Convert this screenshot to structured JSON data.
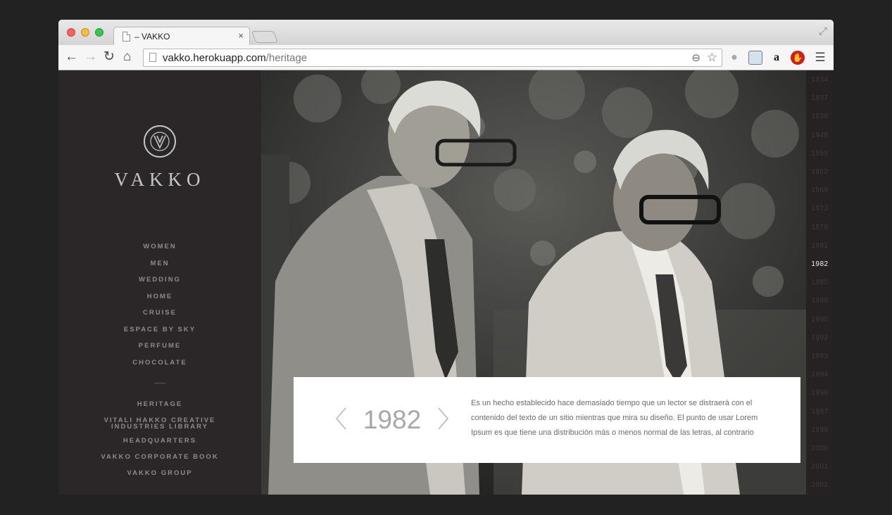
{
  "browser": {
    "tab_title": "– VAKKO",
    "tab_close": "×",
    "url_host": "vakko.herokuapp.com",
    "url_path": "/heritage"
  },
  "sidebar": {
    "logo_text": "VAKKO",
    "nav": [
      "WOMEN",
      "MEN",
      "WEDDING",
      "HOME",
      "CRUISE",
      "ESPACE BY SKY",
      "PERFUME",
      "CHOCOLATE"
    ],
    "nav_secondary": [
      {
        "label": "HERITAGE"
      },
      {
        "label": "VITALI HAKKO CREATIVE INDUSTRIES LIBRARY"
      },
      {
        "label": "HEADQUARTERS"
      },
      {
        "label": "VAKKO CORPORATE BOOK"
      },
      {
        "label": "VAKKO GROUP"
      }
    ]
  },
  "timeline": {
    "years": [
      "1934",
      "1937",
      "1938",
      "1948",
      "1955",
      "1962",
      "1969",
      "1973",
      "1979",
      "1981",
      "1982",
      "1985",
      "1989",
      "1990",
      "1992",
      "1993",
      "1994",
      "1996",
      "1997",
      "1998",
      "2000",
      "2001",
      "2002"
    ],
    "active": "1982"
  },
  "caption": {
    "year": "1982",
    "text": "Es un hecho establecido hace demasiado tiempo que un lector se distraerá con el contenido del texto de un sitio mientras que mira su diseño. El punto de usar Lorem Ipsum es que tiene una distribución más o menos normal de las letras, al contrario"
  },
  "colors": {
    "sidebar_bg": "#2b2728",
    "nav_text": "#8f8b8c",
    "active_year": "#f2f2f2"
  }
}
